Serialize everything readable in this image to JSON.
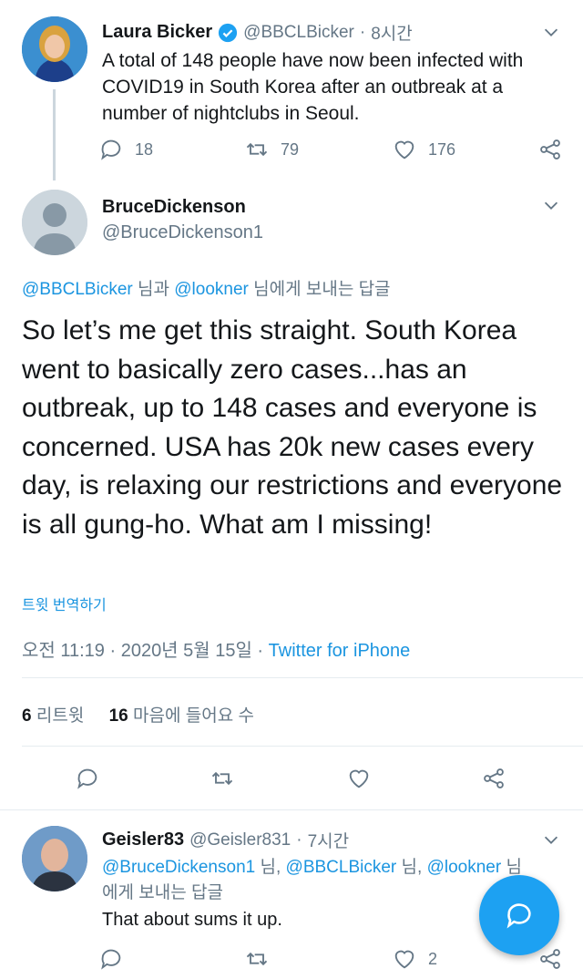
{
  "tweet1": {
    "display_name": "Laura Bicker",
    "handle": "@BBCLBicker",
    "separator": "·",
    "time": "8시간",
    "text": "A total of 148 people have now been infected with COVID19 in South Korea after an outbreak at a number of nightclubs in Seoul.",
    "replies": "18",
    "retweets": "79",
    "likes": "176"
  },
  "main": {
    "display_name": "BruceDickenson",
    "handle": "@BruceDickenson1",
    "reply_to_user1": "@BBCLBicker",
    "reply_mid": " 님과 ",
    "reply_to_user2": "@lookner",
    "reply_suffix": " 님에게 보내는 답글",
    "text": "So let’s me get this straight. South Korea went to basically zero cases...has an outbreak, up to 148 cases and everyone is concerned. USA has 20k new cases every day, is relaxing our restrictions and everyone is all gung-ho. What am I missing!",
    "translate": "트윗 번역하기",
    "timestamp": "오전 11:19 · 2020년 5월 15일",
    "via_sep": " · ",
    "source": "Twitter for iPhone",
    "retweet_count": "6",
    "retweet_label": " 리트윗",
    "like_count": "16",
    "like_label": " 마음에 들어요 수"
  },
  "tweet3": {
    "display_name": "Geisler83",
    "handle": "@Geisler831",
    "separator": "·",
    "time": "7시간",
    "reply_to_user1": "@BruceDickenson1",
    "reply_sep1": " 님, ",
    "reply_to_user2": "@BBCLBicker",
    "reply_sep2": " 님, ",
    "reply_to_user3": "@lookner",
    "reply_suffix": " 님",
    "reply_suffix2": "에게 보내는 답글",
    "text": "That about sums it up.",
    "likes": "2"
  },
  "icons": [
    "verified-badge-icon",
    "chevron-down-icon",
    "reply-icon",
    "retweet-icon",
    "like-icon",
    "share-icon",
    "compose-icon"
  ],
  "colors": {
    "link": "#1b95e0",
    "muted": "#657786",
    "fab": "#1da1f2",
    "verified": "#1da1f2"
  }
}
